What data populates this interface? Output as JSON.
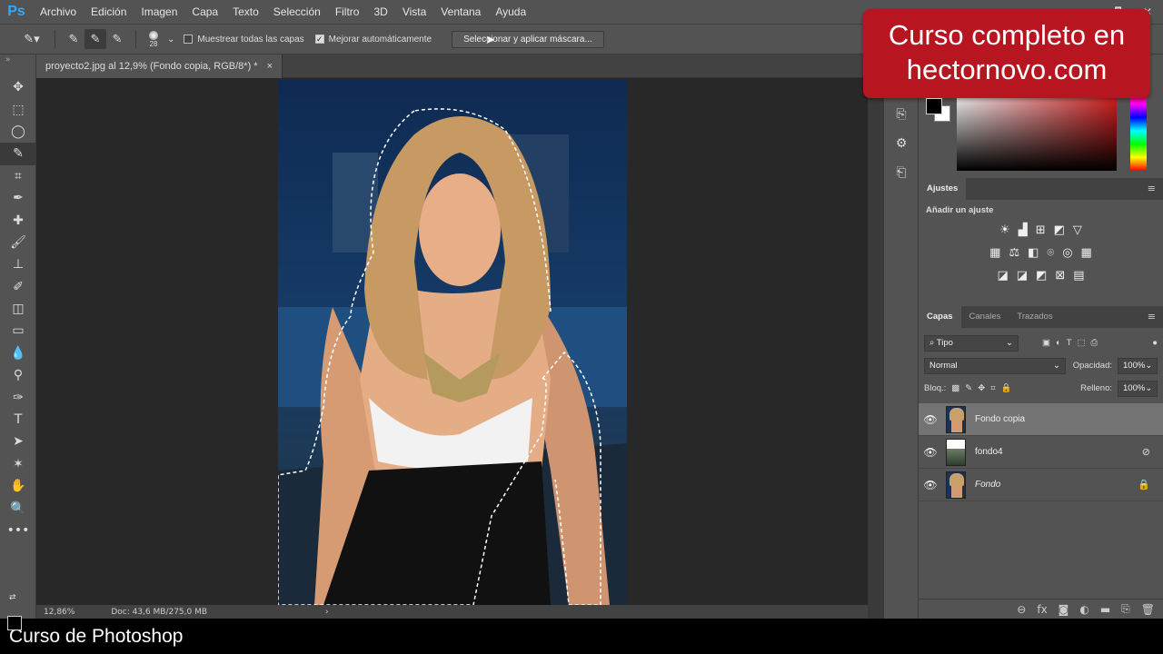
{
  "app": {
    "logo": "Ps"
  },
  "menu": [
    "Archivo",
    "Edición",
    "Imagen",
    "Capa",
    "Texto",
    "Selección",
    "Filtro",
    "3D",
    "Vista",
    "Ventana",
    "Ayuda"
  ],
  "window_controls": {
    "minimize": "▭",
    "restore": "🗗",
    "close": "✕"
  },
  "options_bar": {
    "brush_size": "28",
    "sample_all_layers_label": "Muestrear todas las capas",
    "sample_all_layers_checked": false,
    "auto_enhance_label": "Mejorar automáticamente",
    "auto_enhance_checked": true,
    "mask_button_label": "Seleccionar y aplicar máscara..."
  },
  "document": {
    "tab_title": "proyecto2.jpg al 12,9% (Fondo copia, RGB/8*) *",
    "tab_close": "×",
    "zoom": "12,86%",
    "doc_info": "Doc: 43,6 MB/275,0 MB",
    "status_arrow": "›"
  },
  "tools": [
    "move-tool",
    "marquee-tool",
    "lasso-tool",
    "quick-selection-tool",
    "crop-tool",
    "eyedropper-tool",
    "healing-brush-tool",
    "brush-tool",
    "clone-stamp-tool",
    "history-brush-tool",
    "eraser-tool",
    "gradient-tool",
    "blur-tool",
    "dodge-tool",
    "pen-tool",
    "type-tool",
    "path-selection-tool",
    "shape-tool",
    "hand-tool",
    "zoom-tool",
    "more-tools"
  ],
  "tool_glyphs": [
    "✥",
    "⬚",
    "◯",
    "✎",
    "⌗",
    "✒",
    "✚",
    "🖌",
    "⊥",
    "✐",
    "◫",
    "▭",
    "💧",
    "⚲",
    "✑",
    "T",
    "➤",
    "✶",
    "✋",
    "🔍",
    "•••"
  ],
  "selected_tool": "quick-selection-tool",
  "color_panel": {
    "foreground": "#000000",
    "background": "#ffffff",
    "hue": "#e02020"
  },
  "adjustments": {
    "tab": "Ajustes",
    "title": "Añadir un ajuste",
    "rows": [
      [
        "☀",
        "▟",
        "⊞",
        "◩",
        "▽"
      ],
      [
        "▦",
        "⚖",
        "◧",
        "⌾",
        "◎",
        "▦"
      ],
      [
        "◪",
        "◪",
        "◩",
        "⊠",
        "▤"
      ]
    ]
  },
  "layers_panel": {
    "tabs": [
      "Capas",
      "Canales",
      "Trazados"
    ],
    "filter_label": "Tipo",
    "blend_mode": "Normal",
    "opacity_label": "Opacidad:",
    "opacity": "100%",
    "lock_label": "Bloq.:",
    "fill_label": "Relleno:",
    "fill": "100%",
    "layers": [
      {
        "name": "Fondo copia",
        "visible": true,
        "selected": true,
        "thumb": "portrait"
      },
      {
        "name": "fondo4",
        "visible": true,
        "selected": false,
        "thumb": "landscape"
      },
      {
        "name": "Fondo",
        "visible": true,
        "selected": false,
        "thumb": "portrait",
        "locked": true
      }
    ],
    "footer_icons": [
      "link-icon",
      "fx-icon",
      "mask-icon",
      "adjustment-icon",
      "group-icon",
      "new-layer-icon",
      "trash-icon"
    ]
  },
  "promo": {
    "line1": "Curso completo en",
    "line2": "hectornovo.com"
  },
  "caption": "Curso de Photoshop"
}
